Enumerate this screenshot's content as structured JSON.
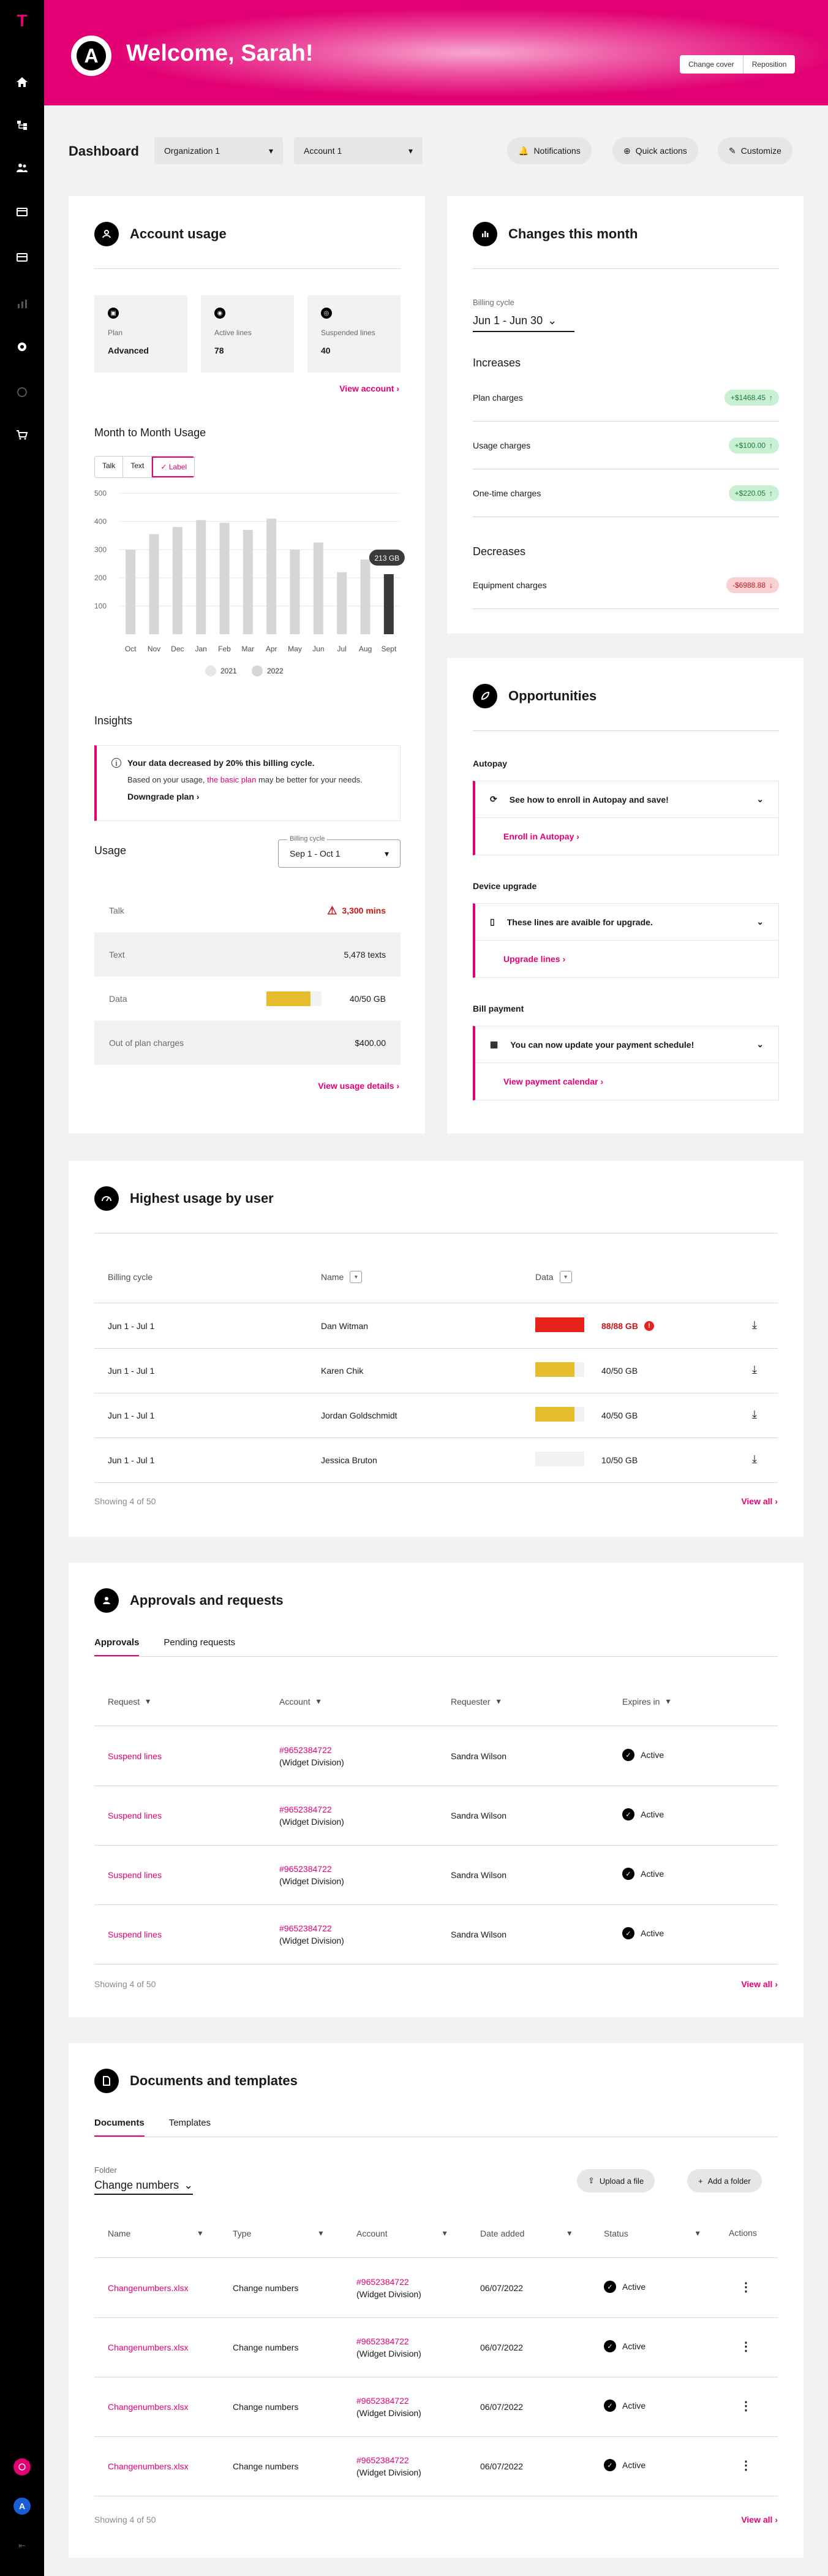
{
  "hero": {
    "title": "Welcome, Sarah!",
    "logo_letter": "A",
    "change_cover": "Change cover",
    "reposition": "Reposition"
  },
  "toolbar": {
    "title": "Dashboard",
    "org": "Organization 1",
    "account": "Account 1",
    "notifications": "Notifications",
    "quick_actions": "Quick actions",
    "customize": "Customize"
  },
  "account_usage": {
    "title": "Account usage",
    "stats": [
      {
        "icon": "plan-icon",
        "label": "Plan",
        "value": "Advanced"
      },
      {
        "icon": "active-lines-icon",
        "label": "Active lines",
        "value": "78"
      },
      {
        "icon": "suspended-lines-icon",
        "label": "Suspended lines",
        "value": "40"
      }
    ],
    "view_account": "View account",
    "mtm_title": "Month to Month Usage",
    "segments": [
      "Talk",
      "Text",
      "Label"
    ],
    "insights_title": "Insights",
    "insight_headline": "Your data decreased by 20% this billing cycle.",
    "insight_body_pre": "Based on your usage,",
    "insight_body_link": "the basic plan",
    "insight_body_post": "may be better for your needs.",
    "downgrade": "Downgrade plan",
    "usage_title": "Usage",
    "billing_cycle_label": "Billing cycle",
    "billing_cycle_value": "Sep 1 - Oct 1",
    "rows": [
      {
        "k": "Talk",
        "v": "3,300 mins"
      },
      {
        "k": "Text",
        "v": "5,478 texts"
      },
      {
        "k": "Data",
        "v": "40/50 GB"
      },
      {
        "k": "Out of plan charges",
        "v": "$400.00"
      }
    ],
    "data_fill": 0.8,
    "view_usage": "View usage details"
  },
  "chart_data": {
    "type": "bar",
    "categories": [
      "Oct",
      "Nov",
      "Dec",
      "Jan",
      "Feb",
      "Mar",
      "Apr",
      "May",
      "Jun",
      "Jul",
      "Aug",
      "Sept"
    ],
    "series": [
      {
        "name": "2021",
        "values": [
          300,
          355,
          380,
          405,
          395,
          370,
          410,
          300,
          325,
          220,
          265,
          250
        ]
      },
      {
        "name": "2022",
        "values": [
          null,
          null,
          null,
          null,
          null,
          null,
          null,
          null,
          null,
          null,
          null,
          213
        ]
      }
    ],
    "tooltip": "213 GB",
    "yticks": [
      100,
      200,
      300,
      400,
      500
    ],
    "ylim": [
      0,
      500
    ],
    "legend": [
      "2021",
      "2022"
    ]
  },
  "changes": {
    "title": "Changes this month",
    "billing_cycle_label": "Billing cycle",
    "billing_cycle_value": "Jun 1 - Jun 30",
    "increases_title": "Increases",
    "increases": [
      {
        "k": "Plan charges",
        "v": "+$1468.45"
      },
      {
        "k": "Usage charges",
        "v": "+$100.00"
      },
      {
        "k": "One-time charges",
        "v": "+$220.05"
      }
    ],
    "decreases_title": "Decreases",
    "decreases": [
      {
        "k": "Equipment charges",
        "v": "-$6988.88"
      }
    ]
  },
  "opportunities": {
    "title": "Opportunities",
    "items": [
      {
        "section": "Autopay",
        "text": "See how to enroll in Autopay and save!",
        "link": "Enroll in Autopay",
        "icon": "refresh-icon"
      },
      {
        "section": "Device upgrade",
        "text": "These lines are avaible for upgrade.",
        "link": "Upgrade lines",
        "icon": "phone-icon"
      },
      {
        "section": "Bill payment",
        "text": "You can now update your payment schedule!",
        "link": "View payment calendar",
        "icon": "calendar-icon"
      }
    ]
  },
  "highest_usage": {
    "title": "Highest usage by user",
    "headers": [
      "Billing cycle",
      "Name",
      "Data"
    ],
    "rows": [
      {
        "cycle": "Jun 1 - Jul 1",
        "name": "Dan Witman",
        "data": "88/88 GB",
        "fill": 1.0,
        "color": "#e8231b",
        "alert": true
      },
      {
        "cycle": "Jun 1 - Jul 1",
        "name": "Karen Chik",
        "data": "40/50 GB",
        "fill": 0.8,
        "color": "#e6bd2e",
        "alert": false
      },
      {
        "cycle": "Jun 1 - Jul 1",
        "name": "Jordan Goldschmidt",
        "data": "40/50 GB",
        "fill": 0.8,
        "color": "#e6bd2e",
        "alert": false
      },
      {
        "cycle": "Jun 1 - Jul 1",
        "name": "Jessica Bruton",
        "data": "10/50 GB",
        "fill": 0.2,
        "color": "#f2f2f2",
        "alert": false
      }
    ],
    "showing": "Showing 4 of 50",
    "view_all": "View all"
  },
  "approvals": {
    "title": "Approvals and requests",
    "tabs": [
      "Approvals",
      "Pending requests"
    ],
    "headers": [
      "Request",
      "Account",
      "Requester",
      "Expires in"
    ],
    "rows": [
      {
        "request": "Suspend lines",
        "account": "#9652384722",
        "division": "(Widget Division)",
        "requester": "Sandra Wilson",
        "status": "Active"
      },
      {
        "request": "Suspend lines",
        "account": "#9652384722",
        "division": "(Widget Division)",
        "requester": "Sandra Wilson",
        "status": "Active"
      },
      {
        "request": "Suspend lines",
        "account": "#9652384722",
        "division": "(Widget Division)",
        "requester": "Sandra Wilson",
        "status": "Active"
      },
      {
        "request": "Suspend lines",
        "account": "#9652384722",
        "division": "(Widget Division)",
        "requester": "Sandra Wilson",
        "status": "Active"
      }
    ],
    "showing": "Showing 4 of 50",
    "view_all": "View all"
  },
  "documents": {
    "title": "Documents and templates",
    "tabs": [
      "Documents",
      "Templates"
    ],
    "folder_label": "Folder",
    "folder_value": "Change numbers",
    "upload": "Upload a file",
    "add_folder": "Add a folder",
    "headers": [
      "Name",
      "Type",
      "Account",
      "Date added",
      "Status",
      "Actions"
    ],
    "rows": [
      {
        "name": "Changenumbers.xlsx",
        "type": "Change numbers",
        "account": "#9652384722",
        "division": "(Widget Division)",
        "date": "06/07/2022",
        "status": "Active"
      },
      {
        "name": "Changenumbers.xlsx",
        "type": "Change numbers",
        "account": "#9652384722",
        "division": "(Widget Division)",
        "date": "06/07/2022",
        "status": "Active"
      },
      {
        "name": "Changenumbers.xlsx",
        "type": "Change numbers",
        "account": "#9652384722",
        "division": "(Widget Division)",
        "date": "06/07/2022",
        "status": "Active"
      },
      {
        "name": "Changenumbers.xlsx",
        "type": "Change numbers",
        "account": "#9652384722",
        "division": "(Widget Division)",
        "date": "06/07/2022",
        "status": "Active"
      }
    ],
    "showing": "Showing 4 of 50",
    "view_all": "View all"
  },
  "sidebar": {
    "items": [
      "home-icon",
      "hierarchy-icon",
      "users-icon",
      "billing-icon",
      "payment-icon",
      "analytics-icon",
      "settings-icon",
      "support-icon",
      "cart-icon"
    ],
    "brand": "T"
  },
  "colors": {
    "brand": "#e20074",
    "success": "#c9f0d3",
    "danger": "#fbd0d0"
  }
}
